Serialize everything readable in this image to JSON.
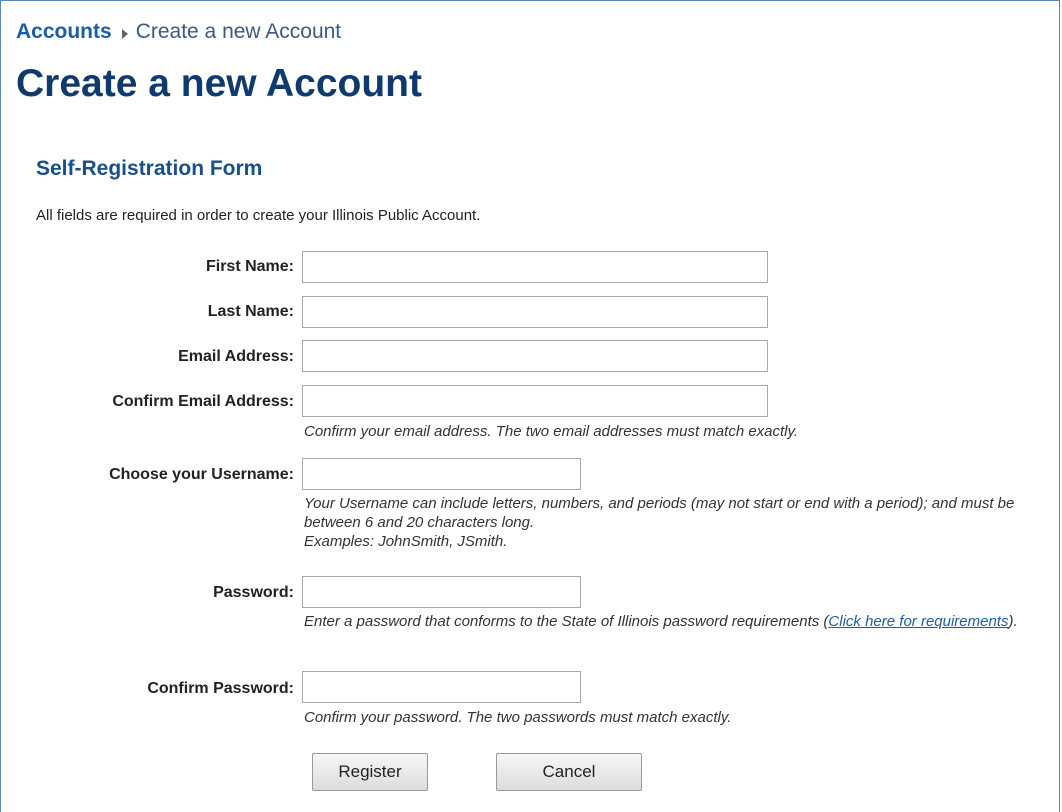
{
  "breadcrumb": {
    "root": "Accounts",
    "current": "Create a new Account"
  },
  "page_title": "Create a new Account",
  "form": {
    "section_title": "Self-Registration Form",
    "intro": "All fields are required in order to create your Illinois Public Account.",
    "fields": {
      "first_name": {
        "label": "First Name:",
        "value": ""
      },
      "last_name": {
        "label": "Last Name:",
        "value": ""
      },
      "email": {
        "label": "Email Address:",
        "value": ""
      },
      "confirm_email": {
        "label": "Confirm Email Address:",
        "value": "",
        "hint": "Confirm your email address. The two email addresses must match exactly."
      },
      "username": {
        "label": "Choose your Username:",
        "value": "",
        "hint": "Your Username can include letters, numbers, and periods (may not start or end with a period); and must be between 6 and 20 characters long.",
        "hint_examples": "Examples: JohnSmith, JSmith."
      },
      "password": {
        "label": "Password:",
        "value": "",
        "hint_prefix": "Enter a password that conforms to the State of Illinois password requirements (",
        "hint_link": "Click here for requirements",
        "hint_suffix": ")."
      },
      "confirm_password": {
        "label": "Confirm Password:",
        "value": "",
        "hint": "Confirm your password. The two passwords must match exactly."
      }
    },
    "buttons": {
      "register": "Register",
      "cancel": "Cancel"
    }
  },
  "colors": {
    "title": "#0f3a6e",
    "link": "#1b5ea8",
    "frame_border": "#5b86b5"
  }
}
